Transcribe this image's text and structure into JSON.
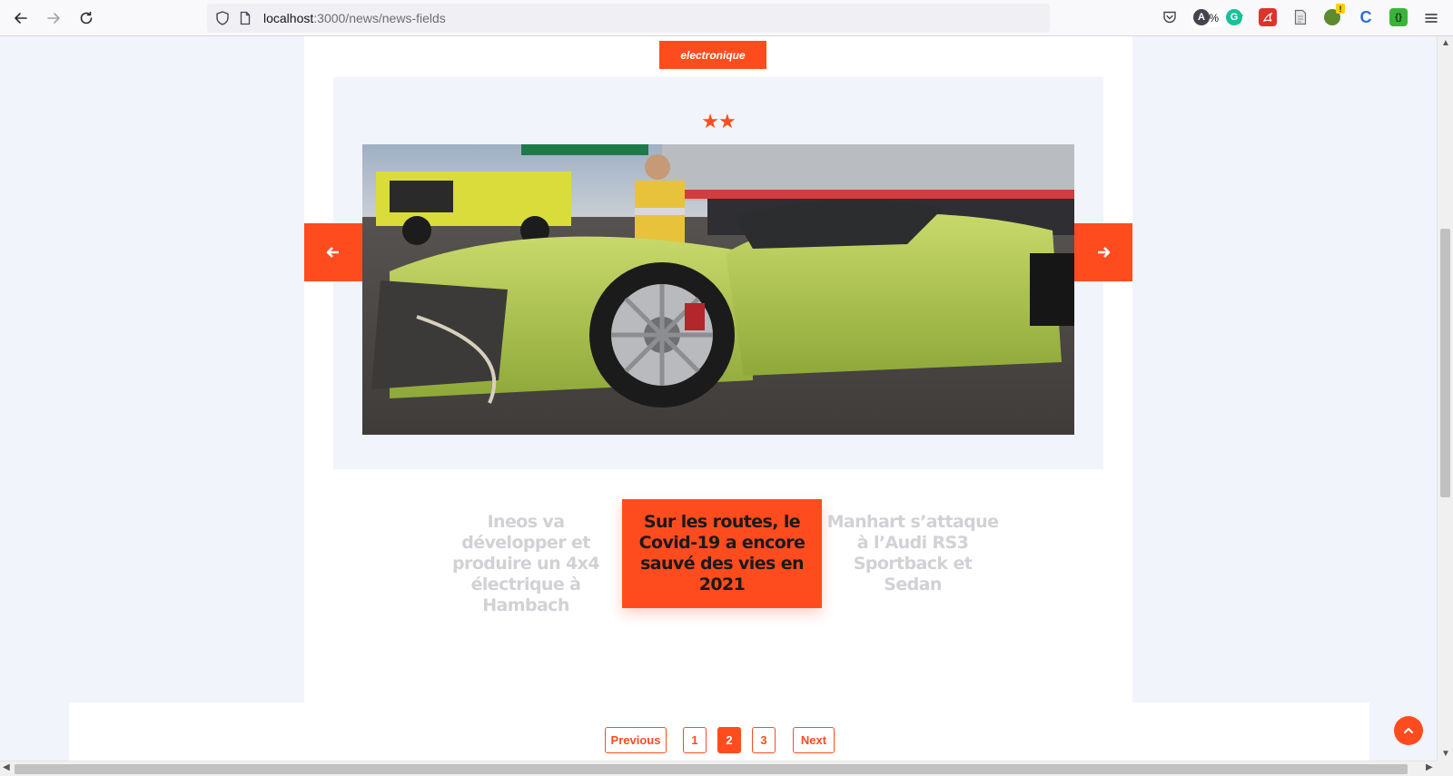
{
  "browser": {
    "url_host": "localhost",
    "url_path": ":3000/news/news-fields",
    "zoom": "80%",
    "icons": {
      "back": "arrow-left-icon",
      "forward": "arrow-right-icon",
      "reload": "reload-icon",
      "shield": "shield-icon",
      "page": "page-icon",
      "bookmark": "star-outline-icon",
      "menu": "hamburger-menu-icon"
    },
    "extensions": [
      {
        "name": "pocket-icon",
        "label": ""
      },
      {
        "name": "account-icon",
        "label": "A"
      },
      {
        "name": "grammarly-icon",
        "label": "G"
      },
      {
        "name": "pdf-icon",
        "label": ""
      },
      {
        "name": "document-icon",
        "label": ""
      },
      {
        "name": "alert-extension-icon",
        "label": "!"
      },
      {
        "name": "c-extension-icon",
        "label": "C"
      },
      {
        "name": "json-extension-icon",
        "label": "{}"
      }
    ]
  },
  "article": {
    "category": "electronique",
    "rating": "★★",
    "photo_alt": "crashed green sports car",
    "prev_icon": "arrow-left-icon",
    "next_icon": "arrow-right-icon"
  },
  "related": {
    "left": "Ineos va développer et produire un 4x4 électrique à Hambach",
    "active": "Sur les routes, le Covid-19 a encore sauvé des vies en 2021",
    "right": "Manhart s’attaque à l’Audi RS3 Sportback et Sedan"
  },
  "pagination": {
    "previous": "Previous",
    "pages": [
      "1",
      "2",
      "3"
    ],
    "current": "2",
    "next": "Next"
  },
  "colors": {
    "accent": "#ff4c1f",
    "muted_text": "#d1d1d6",
    "page_background": "#f1f4fa"
  }
}
